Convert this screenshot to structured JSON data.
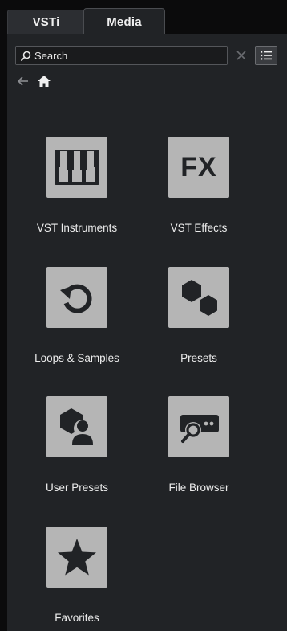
{
  "tabs": [
    {
      "label": "VSTi",
      "active": false
    },
    {
      "label": "Media",
      "active": true
    }
  ],
  "search": {
    "placeholder": "Search",
    "value": ""
  },
  "toolbar": {
    "clear_icon": "close-icon",
    "list_icon": "list-view-icon"
  },
  "nav": {
    "back_icon": "arrow-left-icon",
    "home_icon": "home-icon"
  },
  "tiles": [
    {
      "label": "VST Instruments",
      "icon": "piano-keys-icon"
    },
    {
      "label": "VST Effects",
      "icon": "fx-icon",
      "icon_text": "FX"
    },
    {
      "label": "Loops & Samples",
      "icon": "loop-icon"
    },
    {
      "label": "Presets",
      "icon": "hexagons-icon"
    },
    {
      "label": "User Presets",
      "icon": "user-preset-icon"
    },
    {
      "label": "File Browser",
      "icon": "file-browser-icon"
    },
    {
      "label": "Favorites",
      "icon": "star-icon"
    }
  ],
  "colors": {
    "panel_bg": "#212326",
    "tile_bg": "#b5b5b5",
    "icon_fg": "#212326",
    "text": "#ececec"
  }
}
